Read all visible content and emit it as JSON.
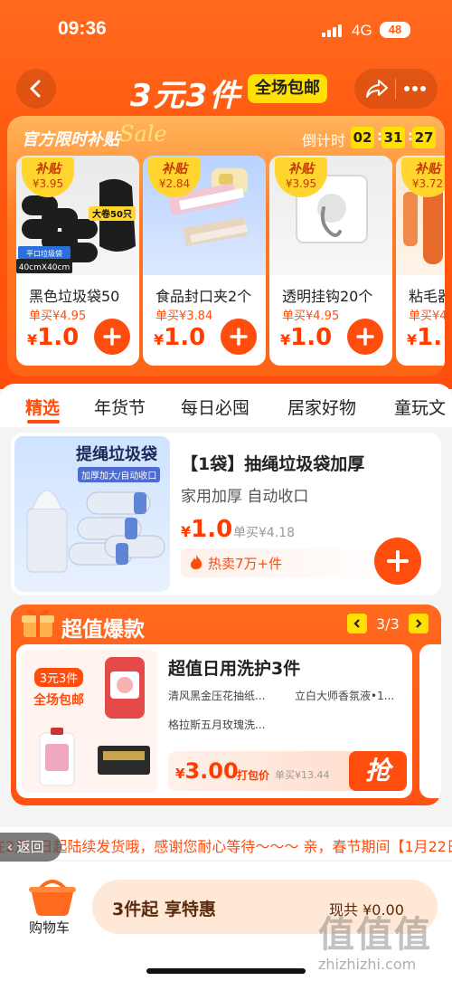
{
  "status": {
    "time": "09:36",
    "network": "4G",
    "battery": "48"
  },
  "header": {
    "title": "3元3件",
    "badge": "全场包邮"
  },
  "subsidy": {
    "title": "官方限时补贴",
    "sale": "Sale",
    "countdown_label": "倒计时",
    "countdown": [
      "02",
      "31",
      "27"
    ],
    "products": [
      {
        "tag": "补贴",
        "subsidy": "¥3.95",
        "name": "黑色垃圾袋50",
        "single": "单买¥4.95",
        "price": "1.0",
        "img_badge": "大卷50只",
        "img_size": "40cmX40cm",
        "img_type": "平口垃圾袋"
      },
      {
        "tag": "补贴",
        "subsidy": "¥2.84",
        "name": "食品封口夹2个",
        "single": "单买¥3.84",
        "price": "1.0"
      },
      {
        "tag": "补贴",
        "subsidy": "¥3.95",
        "name": "透明挂钩20个",
        "single": "单买¥4.95",
        "price": "1.0"
      },
      {
        "tag": "补贴",
        "subsidy": "¥3.72",
        "name": "粘毛器",
        "single": "单买¥4",
        "price": "1."
      }
    ]
  },
  "tabs": [
    "精选",
    "年货节",
    "每日必囤",
    "居家好物",
    "童玩文"
  ],
  "featured": {
    "img_title": "提绳垃圾袋",
    "img_sub": "加厚加大/自动收口",
    "name": "【1袋】抽绳垃圾袋加厚",
    "desc": "家用加厚 自动收口",
    "price": "1.0",
    "orig": "单买¥4.18",
    "hot": "热卖7万+件"
  },
  "deals": {
    "title": "超值爆款",
    "page": "3/3",
    "tag_top": "3元3件",
    "tag_bottom": "全场包邮",
    "name": "超值日用洗护3件",
    "items": [
      "清风黑金压花抽纸...",
      "立白大师香氛液•1...",
      "格拉斯五月玫瑰洗..."
    ],
    "price": "3.00",
    "pack": "打包价",
    "orig": "单买¥13.44",
    "grab": "抢"
  },
  "ticker": "在2月1日起陆续发货哦，感谢您耐心等待～～～ 亲，春节期间【1月22日",
  "return_label": "返回",
  "bottom": {
    "cart": "购物车",
    "checkout": "3件起 享特惠",
    "total": "现共 ¥0.00"
  },
  "watermark": {
    "main": "值值值",
    "sub": "zhizhizhi.com"
  },
  "colors": {
    "brand": "#ff4d0d",
    "accent_yellow": "#ffe000",
    "price": "#ff3d00"
  }
}
